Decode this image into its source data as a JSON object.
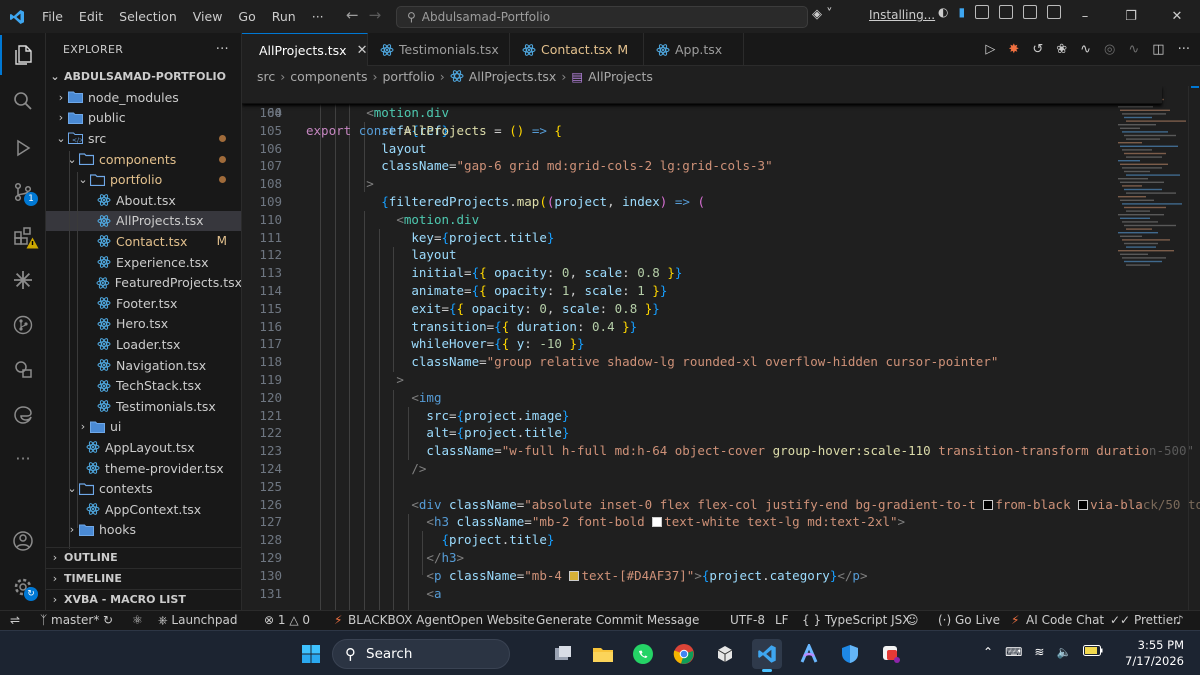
{
  "titlebar": {
    "menu": [
      "File",
      "Edit",
      "Selection",
      "View",
      "Go",
      "Run",
      "···"
    ],
    "search_text": "Abdulsamad-Portfolio",
    "install_label": "Installing..."
  },
  "sidebar": {
    "title": "EXPLORER",
    "root": "ABDULSAMAD-PORTFOLIO",
    "tree": [
      {
        "label": "node_modules",
        "kind": "folder",
        "depth": 1,
        "open": false
      },
      {
        "label": "public",
        "kind": "folder",
        "depth": 1,
        "open": false
      },
      {
        "label": "src",
        "kind": "folder-src",
        "depth": 1,
        "open": true,
        "dot": true
      },
      {
        "label": "components",
        "kind": "folder",
        "depth": 2,
        "open": true,
        "dot": true,
        "mtext": true
      },
      {
        "label": "portfolio",
        "kind": "folder",
        "depth": 3,
        "open": true,
        "dot": true,
        "mtext": true
      },
      {
        "label": "About.tsx",
        "kind": "file",
        "depth": 4
      },
      {
        "label": "AllProjects.tsx",
        "kind": "file",
        "depth": 4,
        "selected": true
      },
      {
        "label": "Contact.tsx",
        "kind": "file",
        "depth": 4,
        "modified": "M"
      },
      {
        "label": "Experience.tsx",
        "kind": "file",
        "depth": 4
      },
      {
        "label": "FeaturedProjects.tsx",
        "kind": "file",
        "depth": 4
      },
      {
        "label": "Footer.tsx",
        "kind": "file",
        "depth": 4
      },
      {
        "label": "Hero.tsx",
        "kind": "file",
        "depth": 4
      },
      {
        "label": "Loader.tsx",
        "kind": "file",
        "depth": 4
      },
      {
        "label": "Navigation.tsx",
        "kind": "file",
        "depth": 4
      },
      {
        "label": "TechStack.tsx",
        "kind": "file",
        "depth": 4
      },
      {
        "label": "Testimonials.tsx",
        "kind": "file",
        "depth": 4
      },
      {
        "label": "ui",
        "kind": "folder",
        "depth": 3,
        "open": false
      },
      {
        "label": "AppLayout.tsx",
        "kind": "file",
        "depth": 3
      },
      {
        "label": "theme-provider.tsx",
        "kind": "file",
        "depth": 3
      },
      {
        "label": "contexts",
        "kind": "folder",
        "depth": 2,
        "open": true
      },
      {
        "label": "AppContext.tsx",
        "kind": "file",
        "depth": 3
      },
      {
        "label": "hooks",
        "kind": "folder",
        "depth": 2,
        "open": false
      }
    ],
    "sections": [
      "OUTLINE",
      "TIMELINE",
      "XVBA - MACRO LIST"
    ]
  },
  "tabs": [
    {
      "label": "AllProjects.tsx",
      "active": true,
      "close": "✕"
    },
    {
      "label": "Testimonials.tsx"
    },
    {
      "label": "Contact.tsx",
      "modified": "M"
    },
    {
      "label": "App.tsx"
    }
  ],
  "breadcrumb": [
    "src",
    "components",
    "portfolio",
    "AllProjects.tsx",
    "AllProjects"
  ],
  "editor": {
    "sticky_line": {
      "num": "60"
    },
    "line_numbers": [
      "104",
      "105",
      "106",
      "107",
      "108",
      "109",
      "110",
      "111",
      "112",
      "113",
      "114",
      "115",
      "116",
      "117",
      "118",
      "119",
      "120",
      "121",
      "122",
      "123",
      "124",
      "125",
      "126",
      "127",
      "128",
      "129",
      "130",
      "131"
    ]
  },
  "statusbar": {
    "branch": "master*",
    "launchpad": "Launchpad",
    "errors": "1",
    "warnings": "0",
    "blackbox": "BLACKBOX Agent",
    "open_website": "Open Website",
    "commit_msg": "Generate Commit Message",
    "encoding": "UTF-8",
    "eol": "LF",
    "language": "TypeScript JSX",
    "golive": "Go Live",
    "aichat": "AI Code Chat",
    "prettier": "Prettier"
  },
  "taskbar": {
    "search": "Search",
    "time": "3:55 PM",
    "date": "7/17/2026"
  },
  "colors": {
    "accent": "#0078d4",
    "modified": "#e2c08d",
    "editor_bg": "#1f1f1f"
  }
}
